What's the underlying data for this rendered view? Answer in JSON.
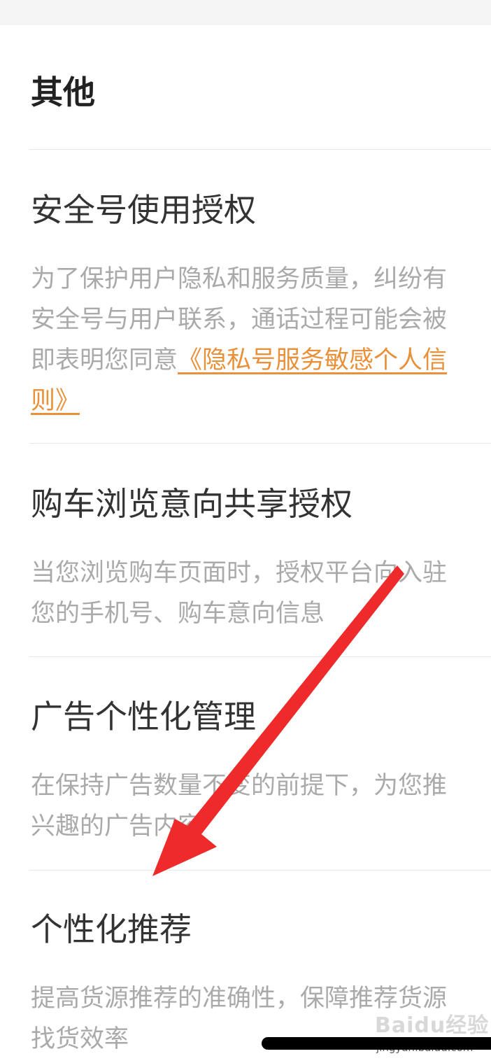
{
  "section": {
    "title": "其他"
  },
  "items": [
    {
      "title": "安全号使用授权",
      "desc_lines": [
        "为了保护用户隐私和服务质量，纠纷有",
        "安全号与用户联系，通话过程可能会被",
        "即表明您同意"
      ],
      "link_part1": "《隐私号服务敏感个人信",
      "link_part2": "则》"
    },
    {
      "title": "购车浏览意向共享授权",
      "desc_lines": [
        "当您浏览购车页面时，授权平台向入驻",
        "您的手机号、购车意向信息"
      ]
    },
    {
      "title": "广告个性化管理",
      "desc_lines": [
        "在保持广告数量不变的前提下，为您推",
        "兴趣的广告内容"
      ]
    },
    {
      "title": "个性化推荐",
      "desc_lines": [
        "提高货源推荐的准确性，保障推荐货源",
        "找货效率"
      ]
    }
  ],
  "watermark": {
    "brand": "Baidu经验",
    "url": "jingyan.baidu.com"
  },
  "colors": {
    "link": "#e8913a",
    "arrow": "#ee2a2a",
    "title": "#333333",
    "desc": "#aaaaaa"
  },
  "icons": {
    "annotation": "red-arrow-icon"
  }
}
